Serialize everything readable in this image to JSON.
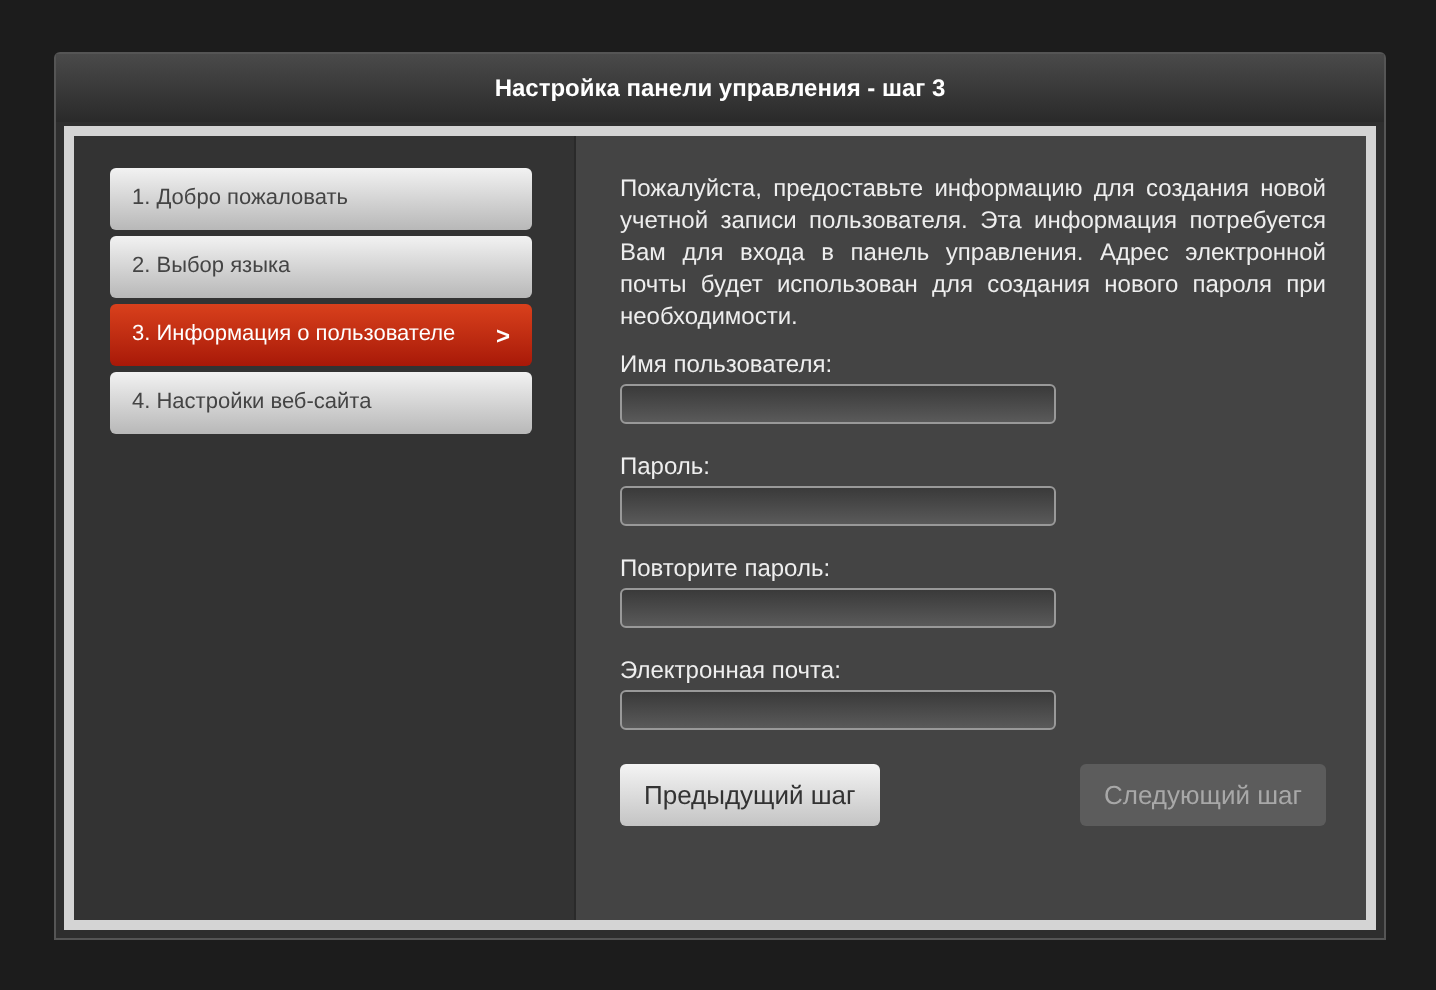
{
  "window": {
    "title": "Настройка панели управления - шаг 3"
  },
  "steps": [
    {
      "label": "1. Добро пожаловать",
      "selected": false
    },
    {
      "label": "2. Выбор языка",
      "selected": false
    },
    {
      "label": "3. Информация о пользователе",
      "selected": true,
      "arrow": ">"
    },
    {
      "label": "4. Настройки веб-сайта",
      "selected": false
    }
  ],
  "intro": "Пожалуйста, предоставьте информацию для создания новой учетной записи пользователя. Эта информация потребуется Вам для входа в панель управления. Адрес электронной почты будет использован для создания нового пароля при необходимости.",
  "fields": [
    {
      "label": "Имя пользователя:"
    },
    {
      "label": "Пароль:"
    },
    {
      "label": "Повторите пароль:"
    },
    {
      "label": "Электронная почта:"
    }
  ],
  "buttons": [
    {
      "label": "Предыдущий шаг",
      "disabled": false
    },
    {
      "label": "Следующий шаг",
      "disabled": true
    }
  ]
}
